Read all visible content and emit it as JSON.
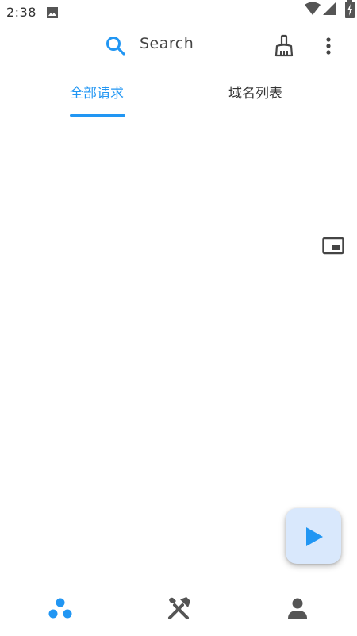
{
  "status_bar": {
    "time": "2:38",
    "icons": [
      "gallery-icon",
      "wifi-icon",
      "signal-icon",
      "battery-charging-icon"
    ]
  },
  "app_bar": {
    "search_label": "Search",
    "icons": [
      "search-icon",
      "broom-icon",
      "more-vert-icon"
    ]
  },
  "tabs": [
    {
      "label": "全部请求",
      "selected": true
    },
    {
      "label": "域名列表",
      "selected": false
    }
  ],
  "floating_icons": [
    "picture-in-picture-icon"
  ],
  "fab": {
    "icon": "play-icon"
  },
  "bottom_nav": [
    {
      "icon": "network-dots-icon",
      "selected": true
    },
    {
      "icon": "tools-icon",
      "selected": false
    },
    {
      "icon": "person-icon",
      "selected": false
    }
  ],
  "colors": {
    "accent": "#2196f3",
    "fab_background": "#d9e8fc",
    "text": "#333333",
    "icon_gray": "#555555"
  }
}
